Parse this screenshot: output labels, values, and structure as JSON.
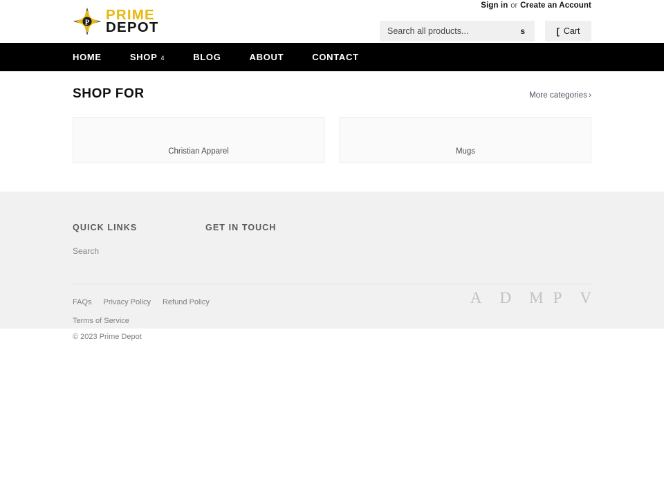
{
  "header": {
    "account": {
      "sign_in": "Sign in",
      "or": "or",
      "create_account": "Create an Account"
    },
    "logo": {
      "line1": "PRIME",
      "line2": "DEPOT",
      "mark_letter": "P",
      "gold": "#e8b80d",
      "black": "#141414"
    },
    "search": {
      "placeholder": "Search all products...",
      "value": "",
      "submit_glyph": "s"
    },
    "cart": {
      "label": "Cart",
      "icon_glyph": "["
    }
  },
  "nav": {
    "items": [
      {
        "label": "HOME",
        "caret": ""
      },
      {
        "label": "SHOP",
        "caret": "4"
      },
      {
        "label": "BLOG",
        "caret": ""
      },
      {
        "label": "ABOUT",
        "caret": ""
      },
      {
        "label": "CONTACT",
        "caret": ""
      }
    ]
  },
  "main": {
    "section_title": "SHOP FOR",
    "more_link": "More categories",
    "more_chevron": "›",
    "categories": [
      {
        "label": "Christian Apparel"
      },
      {
        "label": "Mugs"
      }
    ]
  },
  "footer": {
    "columns": [
      {
        "heading": "QUICK LINKS",
        "links": [
          {
            "label": "Search"
          }
        ]
      },
      {
        "heading": "GET IN TOUCH",
        "links": []
      }
    ],
    "legal_row1": [
      {
        "label": "FAQs"
      },
      {
        "label": "Privacy Policy"
      },
      {
        "label": "Refund Policy"
      }
    ],
    "legal_row2": [
      {
        "label": "Terms of Service"
      }
    ],
    "copyright": {
      "symbol": "©",
      "text": "2023 Prime Depot"
    },
    "payment_icons": [
      {
        "glyph": "A",
        "name": "amex"
      },
      {
        "glyph": "D",
        "name": "discover"
      },
      {
        "glyph": "M",
        "name": "master"
      },
      {
        "glyph": "P",
        "name": "paypal"
      },
      {
        "glyph": "V",
        "name": "visa"
      }
    ]
  }
}
